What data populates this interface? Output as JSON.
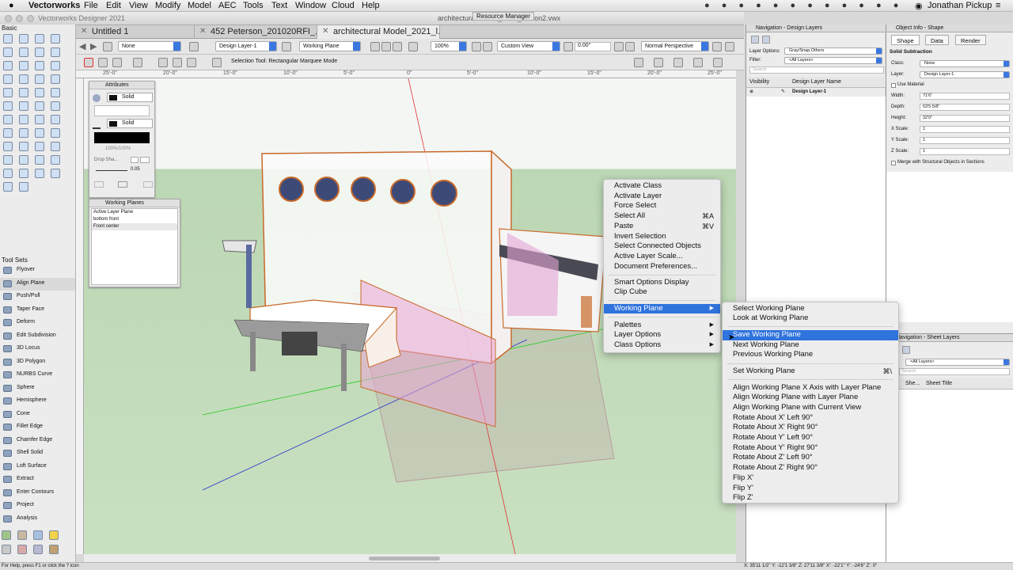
{
  "menubar": {
    "app_name": "Vectorworks",
    "menus": [
      "File",
      "Edit",
      "View",
      "Modify",
      "Model",
      "AEC",
      "Tools",
      "Text",
      "Window",
      "Cloud",
      "Help"
    ],
    "user": "Jonathan Pickup"
  },
  "window": {
    "title": "Vectorworks Designer 2021",
    "doc_title": "architectural Model_2021_lesson2.vwx",
    "resource_manager": "Resource Manager"
  },
  "tabs": [
    "Untitled 1",
    "452 Peterson_201020RFI_...",
    "architectural Model_2021_l..."
  ],
  "toolbar": {
    "class": "None",
    "layer": "Design Layer-1",
    "plane": "Working Plane",
    "zoom": "100%",
    "view": "Custom View",
    "angle": "0.00°",
    "render": "Normal Perspective",
    "mode_hint": "Selection Tool: Rectangular Marquee Mode"
  },
  "ruler": [
    "25'-0\"",
    "20'-0\"",
    "15'-0\"",
    "10'-0\"",
    "5'-0\"",
    "0\"",
    "5'-0\"",
    "10'-0\"",
    "15'-0\"",
    "20'-0\"",
    "25'-0\""
  ],
  "palettes": {
    "basic_title": "Basic",
    "attributes_title": "Attributes",
    "fill_style": "Solid",
    "pen_style": "Solid",
    "opacity": "100%/100%",
    "drop_shadow": "Drop Sha...",
    "line_weight": "0.05",
    "working_planes_title": "Working Planes",
    "working_planes": [
      "Active Layer Plane",
      "bottom front",
      "Front center"
    ],
    "tool_sets_title": "Tool Sets"
  },
  "tool_sets": [
    "Flyover",
    "Align Plane",
    "Push/Pull",
    "Taper Face",
    "Deform",
    "Edit Subdivision",
    "3D Locus",
    "3D Polygon",
    "NURBS Curve",
    "Sphere",
    "Hemisphere",
    "Cone",
    "Fillet Edge",
    "Chamfer Edge",
    "Shell Solid",
    "Loft Surface",
    "Extract",
    "Enter Contours",
    "Project",
    "Analysis"
  ],
  "nav_design_layers": {
    "title": "Navigation - Design Layers",
    "layer_options_label": "Layer Options:",
    "layer_options_value": "Gray/Snap Others",
    "filter_label": "Filter:",
    "filter_value": "<All Layers>",
    "search_placeholder": "Search",
    "col_visibility": "Visibility",
    "col_name": "Design Layer Name",
    "layer_row": "Design Layer-1"
  },
  "object_info": {
    "title": "Object Info - Shape",
    "tabs": [
      "Shape",
      "Data",
      "Render"
    ],
    "object_type": "Solid Subtraction",
    "class_label": "Class:",
    "class_value": "None",
    "layer_label": "Layer:",
    "layer_value": "Design Layer-1",
    "use_material": "Use Material",
    "width_label": "Width:",
    "width_value": "71'6\"",
    "depth_label": "Depth:",
    "depth_value": "63'5 5/8\"",
    "height_label": "Height:",
    "height_value": "32'0\"",
    "xscale_label": "X Scale:",
    "xscale_value": "1",
    "yscale_label": "Y Scale:",
    "yscale_value": "1",
    "zscale_label": "Z Scale:",
    "zscale_value": "1",
    "merge_label": "Merge with Structural Objects in Sections"
  },
  "nav_sheet_layers": {
    "title": "Navigation - Sheet Layers",
    "filter_value": "<All Layers>",
    "search_placeholder": "Search",
    "col_sheet": "She...",
    "col_title": "Sheet Title"
  },
  "context_menu": {
    "items": [
      {
        "label": "Activate Class",
        "shortcut": ""
      },
      {
        "label": "Activate Layer",
        "shortcut": ""
      },
      {
        "label": "Force Select",
        "shortcut": ""
      },
      {
        "label": "Select All",
        "shortcut": "⌘A"
      },
      {
        "label": "Paste",
        "shortcut": "⌘V"
      },
      {
        "label": "Invert Selection",
        "shortcut": ""
      },
      {
        "label": "Select Connected Objects",
        "shortcut": ""
      },
      {
        "label": "Active Layer Scale...",
        "shortcut": ""
      },
      {
        "label": "Document Preferences...",
        "shortcut": ""
      }
    ],
    "items2": [
      "Smart Options Display",
      "Clip Cube"
    ],
    "submenu_item": "Working Plane",
    "items3": [
      "Palettes",
      "Layer Options",
      "Class Options"
    ]
  },
  "submenu": {
    "group1": [
      "Select Working Plane",
      "Look at Working Plane"
    ],
    "highlighted": "Save Working Plane",
    "group2": [
      "Next Working Plane",
      "Previous Working Plane"
    ],
    "set_plane": "Set Working Plane",
    "set_plane_shortcut": "⌘\\",
    "group3": [
      "Align Working Plane X Axis with Layer Plane",
      "Align Working Plane with Layer Plane",
      "Align Working Plane with Current View",
      "Rotate About X' Left 90°",
      "Rotate About X' Right 90°",
      "Rotate About Y' Left 90°",
      "Rotate About Y' Right 90°",
      "Rotate About Z' Left 90°",
      "Rotate About Z' Right 90°",
      "Flip X'",
      "Flip Y'",
      "Flip Z'"
    ]
  },
  "status": {
    "help": "For Help, press F1 or click the ? icon",
    "coords": "X: 35'11 1/2\"   Y: -12'1 3/8\"   Z: 27'11 3/8\"   X': -22'1\"   Y': -24'6\"   Z': 0\""
  }
}
